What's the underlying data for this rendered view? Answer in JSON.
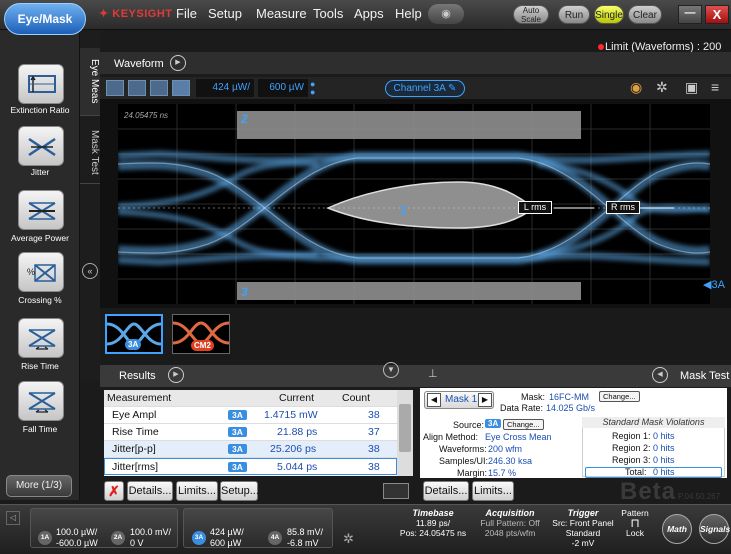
{
  "app": {
    "mode_button": "Eye/Mask",
    "logo": "KEYSIGHT"
  },
  "menu": [
    "File",
    "Setup",
    "Measure",
    "Tools",
    "Apps",
    "Help"
  ],
  "top_controls": {
    "auto_scale": "Auto Scale",
    "run": "Run",
    "single": "Single",
    "clear": "Clear",
    "minimize": "—",
    "close": "X"
  },
  "limit_status": "Limit (Waveforms) : 200",
  "left_panel": {
    "buttons": [
      {
        "label": "Extinction Ratio",
        "icon": "extinction-ratio-icon"
      },
      {
        "label": "Jitter",
        "icon": "jitter-icon"
      },
      {
        "label": "Average Power",
        "icon": "average-power-icon"
      },
      {
        "label": "Crossing %",
        "icon": "crossing-percent-icon"
      },
      {
        "label": "Rise Time",
        "icon": "rise-time-icon"
      },
      {
        "label": "Fall Time",
        "icon": "fall-time-icon"
      }
    ],
    "more": "More (1/3)",
    "tabs": [
      "Eye Meas",
      "Mask Test"
    ]
  },
  "waveform": {
    "title": "Waveform",
    "scale_value": "424 µW/",
    "offset_value": "600 µW",
    "channel_button": "Channel 3A",
    "timestamp": "24.05475 ns",
    "mask_regions": [
      "1",
      "2",
      "3"
    ],
    "markers": {
      "left": "L rms",
      "right": "R rms"
    },
    "channel_marker": "3A"
  },
  "thumbnails": [
    {
      "label": "3A",
      "color": "#3a8ee0"
    },
    {
      "label": "CM2",
      "color": "#e04020"
    }
  ],
  "results": {
    "title": "Results",
    "headers": [
      "Measurement",
      "Current",
      "Count"
    ],
    "rows": [
      {
        "name": "Eye Ampl",
        "src": "3A",
        "current": "1.4715 mW",
        "count": "38"
      },
      {
        "name": "Rise Time",
        "src": "3A",
        "current": "21.88 ps",
        "count": "37"
      },
      {
        "name": "Jitter[p-p]",
        "src": "3A",
        "current": "25.206 ps",
        "count": "38"
      },
      {
        "name": "Jitter[rms]",
        "src": "3A",
        "current": "5.044 ps",
        "count": "38"
      }
    ],
    "buttons": [
      "Details...",
      "Limits...",
      "Setup..."
    ]
  },
  "mask_test": {
    "title": "Mask Test",
    "mask_nav": "Mask 1",
    "mask_label": "Mask:",
    "mask_value": "16FC-MM",
    "change": "Change...",
    "data_rate_label": "Data Rate:",
    "data_rate_value": "14.025 Gb/s",
    "source_label": "Source:",
    "source_value": "3A",
    "align_label": "Align Method:",
    "align_value": "Eye Cross Mean",
    "waveforms_label": "Waveforms:",
    "waveforms_value": "200 wfm",
    "samples_label": "Samples/UI:",
    "samples_value": "246.30 ksa",
    "margin_label": "Margin:",
    "margin_value": "15.7 %",
    "violations_title": "Standard Mask Violations",
    "regions": [
      {
        "label": "Region 1:",
        "value": "0 hits"
      },
      {
        "label": "Region 2:",
        "value": "0 hits"
      },
      {
        "label": "Region 3:",
        "value": "0 hits"
      }
    ],
    "total_label": "Total:",
    "total_value": "0 hits",
    "buttons": [
      "Details...",
      "Limits..."
    ],
    "watermark": "Beta",
    "version": "P.04.50.267"
  },
  "bottom": {
    "ch1": {
      "id": "1A",
      "scale": "100.0 µW/",
      "offset": "-600.0 µW"
    },
    "ch2": {
      "id": "2A",
      "scale": "100.0 mV/",
      "offset": "0 V"
    },
    "ch3": {
      "id": "3A",
      "scale": "424 µW/",
      "offset": "600 µW"
    },
    "ch4": {
      "id": "4A",
      "scale": "85.8 mV/",
      "offset": "-6.8 mV"
    },
    "timebase": {
      "title": "Timebase",
      "l1": "11.89 ps/",
      "l2": "Pos: 24.05475 ns"
    },
    "acquisition": {
      "title": "Acquisition",
      "l1": "Full Pattern: Off",
      "l2": "2048 pts/wfm"
    },
    "trigger": {
      "title": "Trigger",
      "l1": "Src: Front Panel",
      "l2": "Standard",
      "l3": "-2 mV"
    },
    "pattern": {
      "title": "Pattern",
      "l1": "Lock"
    },
    "math": "Math",
    "signals": "Signals"
  },
  "colors": {
    "accent": "#3a8ee0",
    "single": "#e8f24a",
    "limit_dot": "#ff2a2a"
  }
}
